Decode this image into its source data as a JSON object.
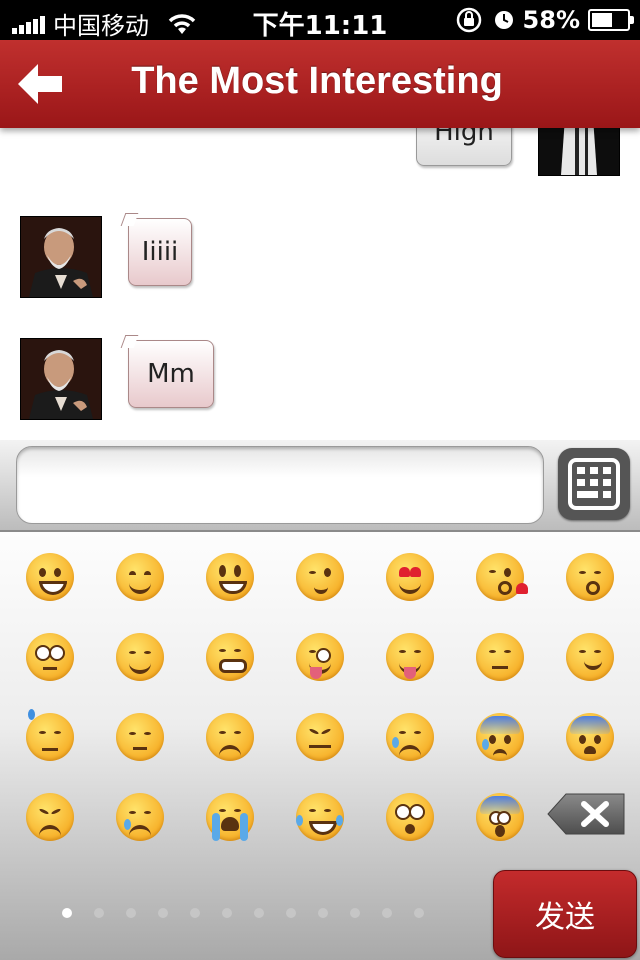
{
  "status_bar": {
    "carrier": "中国移动",
    "time": "下午11:11",
    "battery": "58%",
    "battery_level": 0.58
  },
  "nav": {
    "title": "The Most Interesting",
    "back_icon": "back-arrow-icon"
  },
  "messages": [
    {
      "sender": "me",
      "text": "High"
    },
    {
      "sender": "other",
      "text": "Iiiii"
    },
    {
      "sender": "other",
      "text": "Mm"
    }
  ],
  "input": {
    "value": "",
    "keyboard_icon": "keyboard-icon"
  },
  "emoji_panel": {
    "rows": [
      [
        "grin",
        "smile-blush",
        "smiley",
        "wink",
        "heart-eyes",
        "kiss-heart",
        "kissing-closed-eyes"
      ],
      [
        "flushed",
        "relieved",
        "grimacing",
        "stuck-out-tongue-wink",
        "stuck-out-tongue-closed-eyes",
        "unamused",
        "smirk"
      ],
      [
        "sweat",
        "pensive",
        "disappointed",
        "confounded",
        "disappointed-relieved",
        "cold-sweat",
        "fearful"
      ],
      [
        "persevere",
        "cry",
        "sob",
        "joy",
        "astonished",
        "scream"
      ]
    ],
    "delete_icon": "backspace-icon",
    "page_count": 12,
    "current_page": 1,
    "send_label": "发送"
  },
  "colors": {
    "nav_red": "#b22224",
    "send_red": "#a81e20",
    "bubble_pink": "#e8c9cc"
  }
}
